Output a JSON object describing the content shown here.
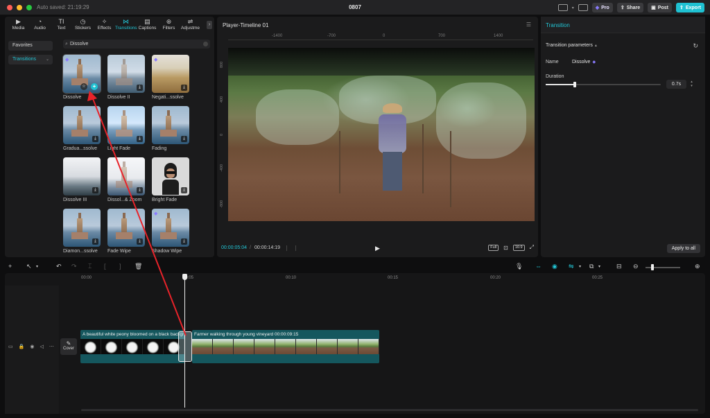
{
  "app": {
    "autosave": "Auto saved: 21:19:29",
    "project_title": "0807",
    "buttons": {
      "pro": "Pro",
      "share": "Share",
      "post": "Post",
      "export": "Export"
    }
  },
  "tools": [
    {
      "label": "Media",
      "icon": "media-icon"
    },
    {
      "label": "Audio",
      "icon": "audio-icon"
    },
    {
      "label": "Text",
      "icon": "text-icon"
    },
    {
      "label": "Stickers",
      "icon": "stickers-icon"
    },
    {
      "label": "Effects",
      "icon": "effects-icon"
    },
    {
      "label": "Transitions",
      "icon": "transitions-icon",
      "active": true
    },
    {
      "label": "Captions",
      "icon": "captions-icon"
    },
    {
      "label": "Filters",
      "icon": "filters-icon"
    },
    {
      "label": "Adjustme",
      "icon": "adjustment-icon"
    }
  ],
  "categories": {
    "favorites": "Favorites",
    "transitions": "Transitions"
  },
  "search": {
    "value": "Dissolve"
  },
  "transitions": [
    {
      "label": "Dissolve",
      "thumb": "tower",
      "pro": true,
      "hover": true
    },
    {
      "label": "Dissolve II",
      "thumb": "tower-fade"
    },
    {
      "label": "Negati...ssolve",
      "thumb": "field",
      "pro": true
    },
    {
      "label": "Gradua...ssolve",
      "thumb": "tower"
    },
    {
      "label": "Light Fade",
      "thumb": "tower-light"
    },
    {
      "label": "Fading",
      "thumb": "tower"
    },
    {
      "label": "Dissolve III",
      "thumb": "snow"
    },
    {
      "label": "Dissol...& Zoom",
      "thumb": "white"
    },
    {
      "label": "Bright Fade",
      "thumb": "person"
    },
    {
      "label": "Diamon...ssolve",
      "thumb": "tower"
    },
    {
      "label": "Fade Wipe",
      "thumb": "tower"
    },
    {
      "label": "Shadow Wipe",
      "thumb": "tower",
      "pro": true
    }
  ],
  "player": {
    "title": "Player-Timeline 01",
    "ruler_x": [
      "-1400",
      "-700",
      "0",
      "700",
      "1400"
    ],
    "ruler_y": [
      "800",
      "400",
      "0",
      "-400",
      "-800"
    ],
    "current_time": "00:00:05:04",
    "separator": "/",
    "total_time": "00:00:14:19",
    "chips": [
      "Full",
      "16:9"
    ]
  },
  "inspector": {
    "title": "Transition",
    "section": "Transition parameters",
    "name_label": "Name",
    "name_value": "Dissolve",
    "duration_label": "Duration",
    "duration_value": "0.7s",
    "duration_fraction": 0.25,
    "apply_all": "Apply to all"
  },
  "timeline": {
    "ruler": [
      "00:00",
      "00:05",
      "00:10",
      "00:15",
      "00:20",
      "00:25"
    ],
    "cover_label": "Cover",
    "clips": [
      {
        "label": "A beautiful white peony bloomed on a black backgr"
      },
      {
        "label": "Farmer walking through young vineyard  00:00:09:15"
      }
    ]
  },
  "colors": {
    "accent": "#22c6d6",
    "annotation_arrow": "#e8232a",
    "clip_bg": "#15575e"
  }
}
